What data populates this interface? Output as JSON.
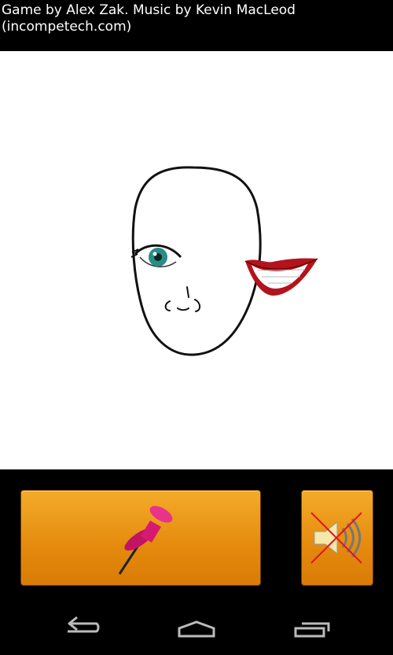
{
  "header": {
    "credits_line1": "Game by Alex Zak. Music by Kevin MacLeod",
    "credits_line2": "(incompetech.com)"
  },
  "canvas": {
    "elements": [
      "face-outline",
      "eye",
      "nose",
      "lips"
    ]
  },
  "controls": {
    "pin_icon": "pushpin-icon",
    "sound_icon": "speaker-muted-icon",
    "sound_muted": true,
    "button_color": "#e8900f"
  },
  "navbar": {
    "back_icon": "back-icon",
    "home_icon": "home-icon",
    "recents_icon": "recents-icon"
  }
}
